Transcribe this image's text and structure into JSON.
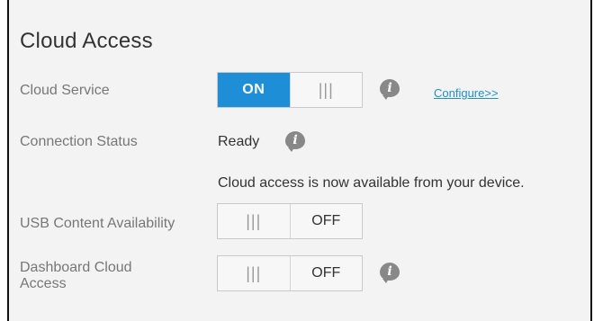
{
  "section": {
    "title": "Cloud Access"
  },
  "cloud_service": {
    "label": "Cloud Service",
    "toggle_state": "ON",
    "on_label": "ON",
    "grip": "|||",
    "configure_link": "Configure>>"
  },
  "connection_status": {
    "label": "Connection Status",
    "value": "Ready",
    "message": "Cloud access is now available from your device."
  },
  "usb_content": {
    "label": "USB Content Availability",
    "toggle_state": "OFF",
    "grip": "|||",
    "off_label": "OFF"
  },
  "dashboard_cloud": {
    "label_line1": "Dashboard Cloud",
    "label_line2": "Access",
    "toggle_state": "OFF",
    "grip": "|||",
    "off_label": "OFF"
  },
  "icons": {
    "info": "i"
  },
  "colors": {
    "accent": "#1e8fd6",
    "panel_bg": "#f3f3f3",
    "label": "#777777"
  }
}
